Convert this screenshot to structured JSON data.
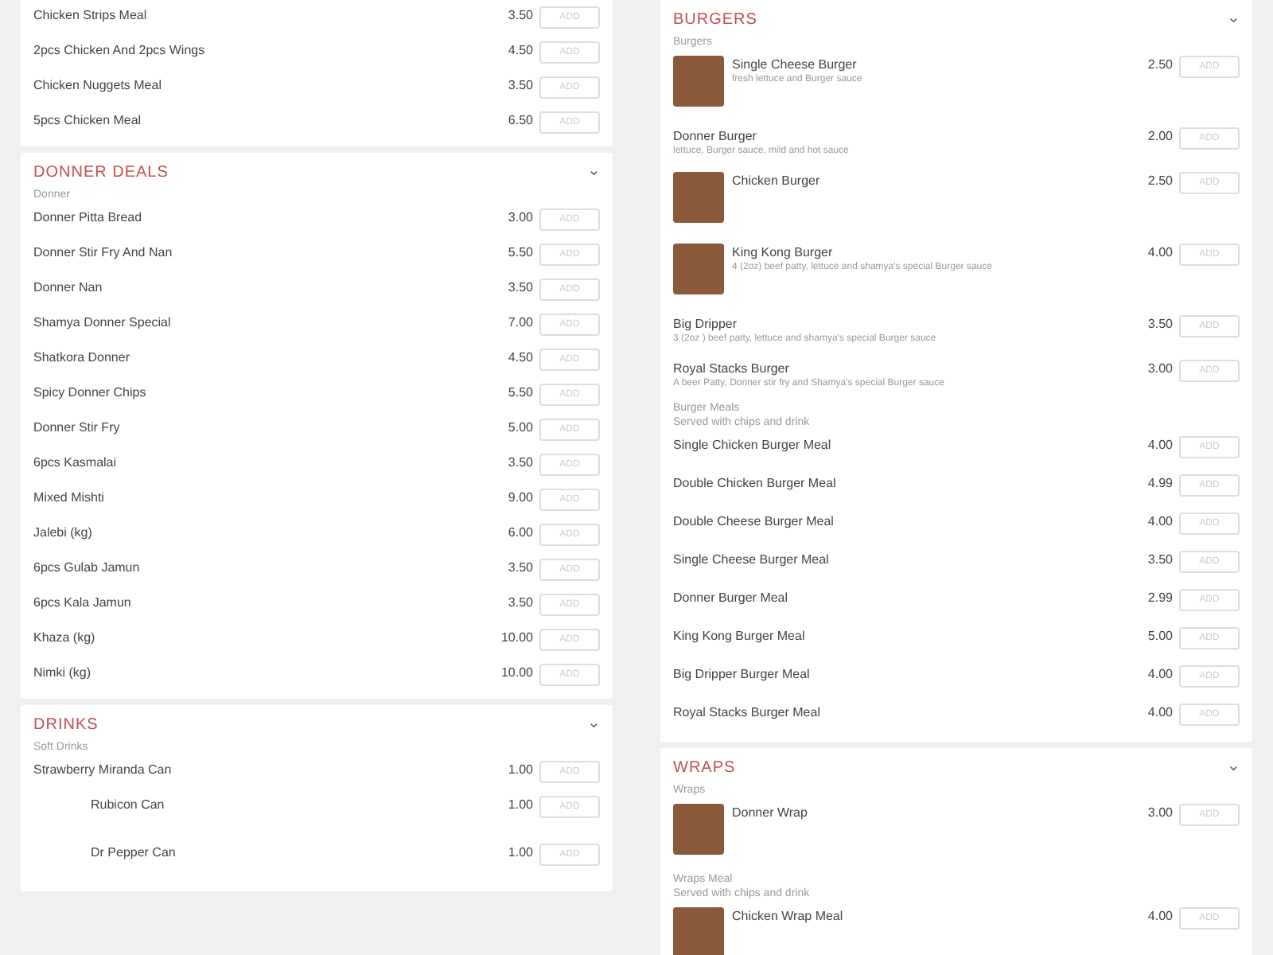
{
  "columns": [
    {
      "sections": [
        {
          "groups": [
            {
              "items": [
                {
                  "kind": "plain",
                  "name": "Chicken Strips Meal",
                  "price": "3.50",
                  "button": "ADD"
                },
                {
                  "kind": "plain",
                  "name": "2pcs Chicken And 2pcs Wings",
                  "price": "4.50",
                  "button": "ADD"
                },
                {
                  "kind": "plain",
                  "name": "Chicken Nuggets Meal",
                  "price": "3.50",
                  "button": "ADD"
                },
                {
                  "kind": "plain",
                  "name": "5pcs Chicken Meal",
                  "price": "6.50",
                  "button": "ADD"
                }
              ]
            }
          ]
        },
        {
          "title": "DONNER DEALS",
          "toggle": "⌄",
          "groups": [
            {
              "name": "Donner",
              "items": [
                {
                  "kind": "plain",
                  "name": "Donner Pitta Bread",
                  "price": "3.00",
                  "button": "ADD"
                },
                {
                  "kind": "plain",
                  "name": "Donner Stir Fry And Nan",
                  "price": "5.50",
                  "button": "ADD"
                },
                {
                  "kind": "plain",
                  "name": "Donner Nan",
                  "price": "3.50",
                  "button": "ADD"
                },
                {
                  "kind": "plain",
                  "name": "Shamya Donner Special",
                  "price": "7.00",
                  "button": "ADD"
                },
                {
                  "kind": "plain",
                  "name": "Shatkora Donner",
                  "price": "4.50",
                  "button": "ADD"
                },
                {
                  "kind": "plain",
                  "name": "Spicy Donner Chips",
                  "price": "5.50",
                  "button": "ADD"
                },
                {
                  "kind": "plain",
                  "name": "Donner Stir Fry",
                  "price": "5.00",
                  "button": "ADD"
                }
              ]
            },
            {
              "items": [
                {
                  "kind": "plain",
                  "name": "6pcs Kasmalai",
                  "price": "3.50",
                  "button": "ADD"
                },
                {
                  "kind": "plain",
                  "name": "Mixed Mishti",
                  "price": "9.00",
                  "button": "ADD"
                },
                {
                  "kind": "plain",
                  "name": "Jalebi (kg)",
                  "price": "6.00",
                  "button": "ADD"
                },
                {
                  "kind": "plain",
                  "name": "6pcs Gulab Jamun",
                  "price": "3.50",
                  "button": "ADD"
                },
                {
                  "kind": "plain",
                  "name": "6pcs Kala Jamun",
                  "price": "3.50",
                  "button": "ADD"
                },
                {
                  "kind": "plain",
                  "name": "Khaza (kg)",
                  "price": "10.00",
                  "button": "ADD"
                },
                {
                  "kind": "plain",
                  "name": "Nimki (kg)",
                  "price": "10.00",
                  "button": "ADD"
                }
              ]
            }
          ]
        },
        {
          "title": "DRINKS",
          "toggle": "⌄",
          "groups": [
            {
              "name": "Soft Drinks",
              "items": [
                {
                  "kind": "plain",
                  "name": "Strawberry Miranda Can",
                  "price": "1.00",
                  "button": "ADD"
                },
                {
                  "kind": "blank_photo",
                  "name": "Rubicon Can",
                  "price": "1.00",
                  "button": "ADD"
                },
                {
                  "kind": "blank_photo",
                  "name": "Dr Pepper Can",
                  "price": "1.00",
                  "button": "ADD"
                }
              ]
            }
          ]
        }
      ]
    },
    {
      "sections": [
        {
          "title": "BURGERS",
          "toggle": "⌄",
          "groups": [
            {
              "name": "Burgers",
              "items": [
                {
                  "kind": "photo",
                  "name": "Single Cheese Burger",
                  "description": "fresh lettuce and Burger sauce",
                  "price": "2.50",
                  "button": "ADD"
                },
                {
                  "kind": "plain",
                  "name": "Donner Burger",
                  "description": "lettuce, Burger sauce, mild and hot sauce",
                  "price": "2.00",
                  "button": "ADD"
                },
                {
                  "kind": "photo",
                  "name": "Chicken Burger",
                  "price": "2.50",
                  "button": "ADD"
                },
                {
                  "kind": "photo",
                  "name": "King Kong Burger",
                  "description": "4 (2oz) beef patty, lettuce and shamya's special Burger sauce",
                  "price": "4.00",
                  "button": "ADD"
                },
                {
                  "kind": "plain",
                  "name": "Big Dripper",
                  "description": "3 (2oz ) beef patty, lettuce and shamya's special Burger sauce",
                  "price": "3.50",
                  "button": "ADD"
                },
                {
                  "kind": "plain",
                  "name": "Royal Stacks Burger",
                  "description": "A beer Patty, Donner stir fry and Shamya's special Burger sauce",
                  "price": "3.00",
                  "button": "ADD"
                }
              ]
            },
            {
              "name": "Burger Meals",
              "note": "Served with chips and drink",
              "items": [
                {
                  "kind": "plain",
                  "name": "Single Chicken Burger Meal",
                  "price": "4.00",
                  "button": "ADD"
                },
                {
                  "kind": "plain",
                  "name": "Double Chicken Burger Meal",
                  "price": "4.99",
                  "button": "ADD"
                },
                {
                  "kind": "plain",
                  "name": "Double Cheese Burger Meal",
                  "price": "4.00",
                  "button": "ADD"
                },
                {
                  "kind": "plain",
                  "name": "Single Cheese Burger Meal",
                  "price": "3.50",
                  "button": "ADD"
                },
                {
                  "kind": "plain",
                  "name": "Donner Burger Meal",
                  "price": "2.99",
                  "button": "ADD"
                },
                {
                  "kind": "plain",
                  "name": "King Kong Burger Meal",
                  "price": "5.00",
                  "button": "ADD"
                },
                {
                  "kind": "plain",
                  "name": "Big Dripper Burger Meal",
                  "price": "4.00",
                  "button": "ADD"
                },
                {
                  "kind": "plain",
                  "name": "Royal Stacks Burger Meal",
                  "price": "4.00",
                  "button": "ADD"
                }
              ]
            }
          ]
        },
        {
          "title": "WRAPS",
          "toggle": "⌄",
          "groups": [
            {
              "name": "Wraps",
              "items": [
                {
                  "kind": "photo",
                  "name": "Donner Wrap",
                  "price": "3.00",
                  "button": "ADD"
                }
              ]
            },
            {
              "name": "Wraps Meal",
              "note": "Served with chips and drink",
              "items": [
                {
                  "kind": "photo",
                  "name": "Chicken Wrap Meal",
                  "price": "4.00",
                  "button": "ADD"
                }
              ]
            }
          ]
        }
      ]
    }
  ]
}
